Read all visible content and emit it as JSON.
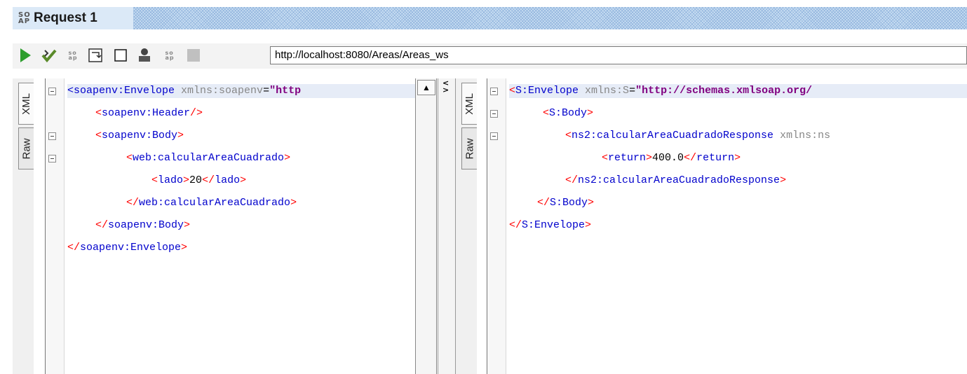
{
  "window": {
    "title": "Request 1",
    "badge": "SO AP"
  },
  "toolbar": {
    "url": "http://localhost:8080/Areas/Areas_ws",
    "buttons": [
      "run-icon",
      "validate-icon",
      "soap-format-icon",
      "wrap-icon",
      "checkbox-icon",
      "user-icon",
      "soap-icon",
      "stop-icon"
    ]
  },
  "request": {
    "tabs": {
      "xml": "XML",
      "raw": "Raw"
    },
    "lines": [
      {
        "parts": [
          [
            "t",
            "<soapenv:Envelope "
          ],
          [
            "a",
            "xmlns:soapenv"
          ],
          [
            "tx",
            "="
          ],
          [
            "v",
            "\"http"
          ]
        ]
      },
      {
        "parts": [
          [
            "b",
            "<"
          ],
          [
            "t",
            "soapenv:Header"
          ],
          [
            "b",
            "/>"
          ]
        ]
      },
      {
        "parts": [
          [
            "b",
            "<"
          ],
          [
            "t",
            "soapenv:Body"
          ],
          [
            "b",
            ">"
          ]
        ]
      },
      {
        "parts": [
          [
            "b",
            "<"
          ],
          [
            "t",
            "web:calcularAreaCuadrado"
          ],
          [
            "b",
            ">"
          ]
        ]
      },
      {
        "parts": [
          [
            "b",
            "<"
          ],
          [
            "t",
            "lado"
          ],
          [
            "b",
            ">"
          ],
          [
            "tx",
            "20"
          ],
          [
            "b",
            "</"
          ],
          [
            "t",
            "lado"
          ],
          [
            "b",
            ">"
          ]
        ]
      },
      {
        "parts": [
          [
            "b",
            "</"
          ],
          [
            "t",
            "web:calcularAreaCuadrado"
          ],
          [
            "b",
            ">"
          ]
        ]
      },
      {
        "parts": [
          [
            "b",
            "</"
          ],
          [
            "t",
            "soapenv:Body"
          ],
          [
            "b",
            ">"
          ]
        ]
      },
      {
        "parts": [
          [
            "b",
            "</"
          ],
          [
            "t",
            "soapenv:Envelope"
          ],
          [
            "b",
            ">"
          ]
        ]
      }
    ]
  },
  "response": {
    "tabs": {
      "xml": "XML",
      "raw": "Raw"
    },
    "lines": [
      {
        "parts": [
          [
            "b",
            "<"
          ],
          [
            "t",
            "S:Envelope "
          ],
          [
            "a",
            "xmlns:S"
          ],
          [
            "tx",
            "="
          ],
          [
            "v",
            "\"http://schemas.xmlsoap.org/"
          ]
        ]
      },
      {
        "parts": [
          [
            "b",
            "<"
          ],
          [
            "t",
            "S:Body"
          ],
          [
            "b",
            ">"
          ]
        ]
      },
      {
        "parts": [
          [
            "b",
            "<"
          ],
          [
            "t",
            "ns2:calcularAreaCuadradoResponse "
          ],
          [
            "a",
            "xmlns:ns"
          ]
        ]
      },
      {
        "parts": [
          [
            "b",
            "<"
          ],
          [
            "t",
            "return"
          ],
          [
            "b",
            ">"
          ],
          [
            "tx",
            "400.0"
          ],
          [
            "b",
            "</"
          ],
          [
            "t",
            "return"
          ],
          [
            "b",
            ">"
          ]
        ]
      },
      {
        "parts": [
          [
            "b",
            "</"
          ],
          [
            "t",
            "ns2:calcularAreaCuadradoResponse"
          ],
          [
            "b",
            ">"
          ]
        ]
      },
      {
        "parts": [
          [
            "b",
            "</"
          ],
          [
            "t",
            "S:Body"
          ],
          [
            "b",
            ">"
          ]
        ]
      },
      {
        "parts": [
          [
            "b",
            "</"
          ],
          [
            "t",
            "S:Envelope"
          ],
          [
            "b",
            ">"
          ]
        ]
      }
    ]
  }
}
